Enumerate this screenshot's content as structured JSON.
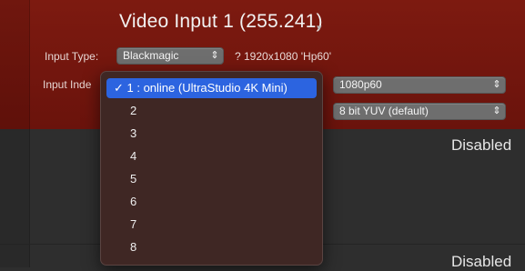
{
  "header": {
    "title": "Video Input 1 (255.241)",
    "title_caret": "▾"
  },
  "input_type": {
    "label": "Input Type:",
    "value": "Blackmagic",
    "stepper": "⇕",
    "resolution": "? 1920x1080 'Hp60'"
  },
  "input_index": {
    "label": "Input Inde"
  },
  "format": {
    "value": "1080p60",
    "stepper": "⇕"
  },
  "pixel_format": {
    "value": "8 bit YUV (default)",
    "stepper": "⇕"
  },
  "status": {
    "row1": "Disabled",
    "row2": "Disabled"
  },
  "menu": {
    "items": [
      "✓ 1 : online (UltraStudio 4K Mini)",
      "2",
      "3",
      "4",
      "5",
      "6",
      "7",
      "8"
    ],
    "selected_index": 0
  },
  "colors": {
    "panel_red": "#7d1a10",
    "selection_blue": "#2c64e0",
    "menu_bg": "#3f2724"
  }
}
